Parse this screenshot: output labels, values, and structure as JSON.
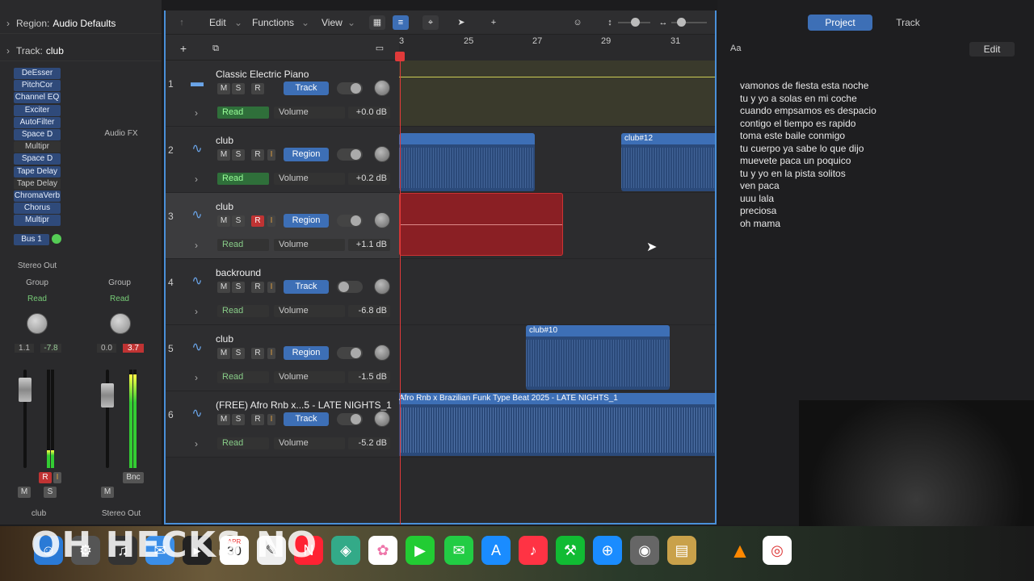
{
  "inspector": {
    "region_label": "Region:",
    "region_value": "Audio Defaults",
    "track_label": "Track:",
    "track_value": "club",
    "plugins": [
      "DeEsser",
      "PitchCor",
      "Channel EQ",
      "Exciter",
      "AutoFilter",
      "Space D",
      "Multipr",
      "Space D",
      "Tape Delay",
      "Tape Delay",
      "ChromaVerb",
      "Chorus",
      "Multipr"
    ],
    "audio_fx": "Audio FX",
    "bus": "Bus 1",
    "stereo_out": "Stereo Out",
    "group": "Group",
    "read": "Read",
    "left_vals": [
      "1.1",
      "-7.8"
    ],
    "right_vals": [
      "0.0",
      "3.7"
    ],
    "m": "M",
    "s": "S",
    "r": "R",
    "i": "I",
    "bnc": "Bnc",
    "strip1_name": "club",
    "strip2_name": "Stereo Out",
    "left_meter_level": 0.18,
    "right_meter_level": 0.95
  },
  "toolbar": {
    "edit": "Edit",
    "functions": "Functions",
    "view": "View"
  },
  "ruler": {
    "bars": [
      "3",
      "25",
      "27",
      "29",
      "31"
    ]
  },
  "tracks": [
    {
      "num": "1",
      "name": "Classic Electric Piano",
      "button": "Track",
      "read": "Read",
      "param": "Volume",
      "db": "+0.0 dB"
    },
    {
      "num": "2",
      "name": "club",
      "button": "Region",
      "read": "Read",
      "param": "Volume",
      "db": "+0.2 dB"
    },
    {
      "num": "3",
      "name": "club",
      "button": "Region",
      "read": "Read",
      "param": "Volume",
      "db": "+1.1 dB"
    },
    {
      "num": "4",
      "name": "backround",
      "button": "Track",
      "read": "Read",
      "param": "Volume",
      "db": "-6.8 dB"
    },
    {
      "num": "5",
      "name": "club",
      "button": "Region",
      "read": "Read",
      "param": "Volume",
      "db": "-1.5 dB"
    },
    {
      "num": "6",
      "name": "(FREE) Afro Rnb x...5 - LATE NIGHTS_1",
      "button": "Track",
      "read": "Read",
      "param": "Volume",
      "db": "-5.2 dB"
    }
  ],
  "regions": {
    "r2b": "club#12",
    "r5": "club#10",
    "r6": "Afro Rnb x Brazilian Funk Type Beat 2025 - LATE NIGHTS_1"
  },
  "right_panel": {
    "tab_project": "Project",
    "tab_track": "Track",
    "aa": "Aa",
    "edit": "Edit",
    "lyrics": [
      "vamonos de fiesta esta noche",
      "tu y yo a solas en mi coche",
      "cuando empsamos es despacio",
      "contigo el tiempo es rapido",
      "toma este baile conmigo",
      "tu cuerpo ya sabe lo que dijo",
      "muevete paca un poquico",
      "tu y yo en la pista solitos",
      "ven paca",
      "uuu lala",
      "preciosa",
      "oh mama"
    ]
  },
  "dock": {
    "calendar_month": "APR",
    "calendar_day": "30",
    "overlay": "OH HECKS NO"
  }
}
